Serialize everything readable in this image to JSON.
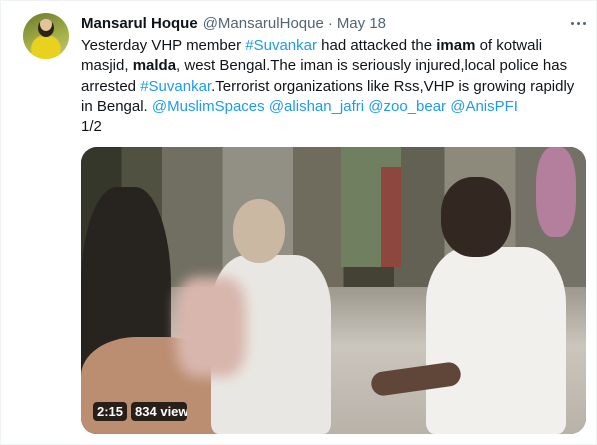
{
  "tweet": {
    "author_name": "Mansarul Hoque",
    "author_handle": "@MansarulHoque",
    "separator": "·",
    "date": "May 18",
    "text_segments": [
      {
        "t": "Yesterday VHP member ",
        "style": "plain"
      },
      {
        "t": "#Suvankar",
        "style": "link"
      },
      {
        "t": " had attacked the ",
        "style": "plain"
      },
      {
        "t": "imam",
        "style": "bold"
      },
      {
        "t": " of kotwali masjid, ",
        "style": "plain"
      },
      {
        "t": "malda",
        "style": "bold"
      },
      {
        "t": ", west Bengal.The iman is seriously injured,local police has arrested ",
        "style": "plain"
      },
      {
        "t": "#Suvankar",
        "style": "link"
      },
      {
        "t": ".Terrorist organizations like Rss,VHP is growing rapidly in Bengal. ",
        "style": "plain"
      },
      {
        "t": "@MuslimSpaces",
        "style": "link"
      },
      {
        "t": " ",
        "style": "plain"
      },
      {
        "t": "@alishan_jafri",
        "style": "link"
      },
      {
        "t": " ",
        "style": "plain"
      },
      {
        "t": "@zoo_bear",
        "style": "link"
      },
      {
        "t": " ",
        "style": "plain"
      },
      {
        "t": "@AnisPFI",
        "style": "link"
      }
    ],
    "thread_count": "1/2",
    "video": {
      "duration": "2:15",
      "views": "834 views"
    }
  },
  "colors": {
    "link": "#1d9bf0",
    "text": "#0f1419",
    "secondary": "#536471"
  },
  "icons": {
    "more": "more-horizontal-icon"
  }
}
